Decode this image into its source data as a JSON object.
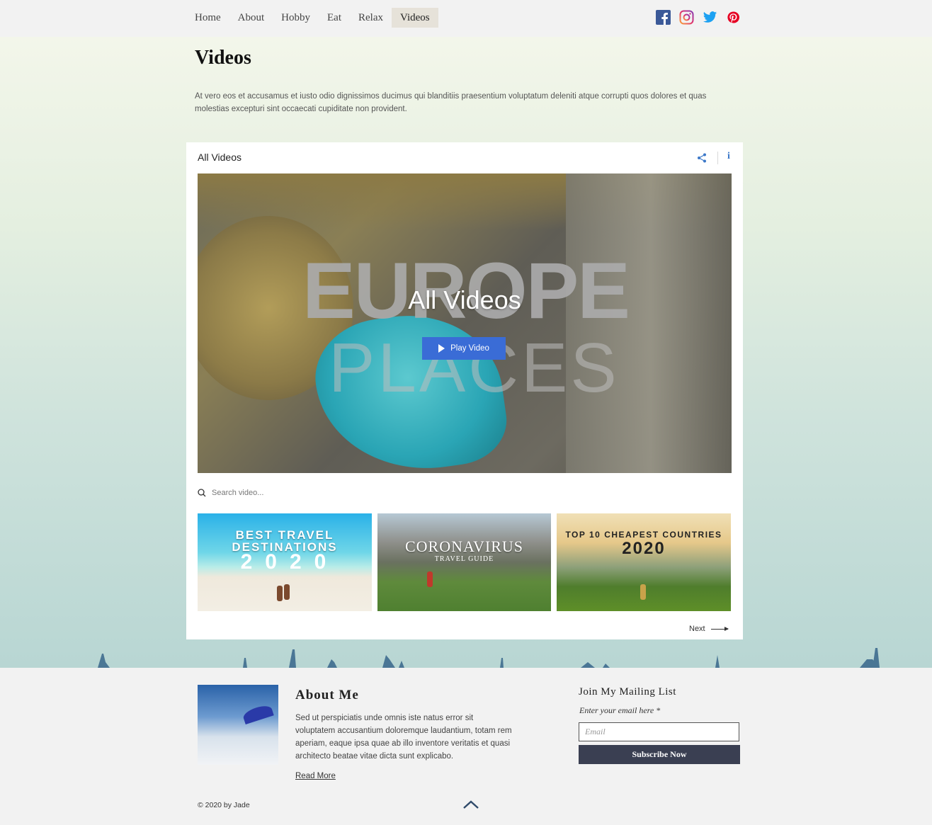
{
  "nav": {
    "items": [
      {
        "label": "Home",
        "active": false
      },
      {
        "label": "About",
        "active": false
      },
      {
        "label": "Hobby",
        "active": false
      },
      {
        "label": "Eat",
        "active": false
      },
      {
        "label": "Relax",
        "active": false
      },
      {
        "label": "Videos",
        "active": true
      }
    ],
    "social": [
      "facebook-icon",
      "instagram-icon",
      "twitter-icon",
      "pinterest-icon"
    ]
  },
  "page": {
    "title": "Videos",
    "intro": "At vero eos et accusamus et iusto odio dignissimos ducimus qui blanditiis praesentium voluptatum deleniti atque corrupti quos dolores et quas molestias excepturi sint occaecati cupiditate non provident."
  },
  "widget": {
    "title": "All Videos",
    "player": {
      "overlay_title": "All Videos",
      "play_label": "Play Video",
      "bg_text_1": "EUROPE",
      "bg_text_2": "PLACES"
    },
    "search": {
      "placeholder": "Search video..."
    },
    "thumbnails": [
      {
        "line1": "BEST TRAVEL DESTINATIONS",
        "line2": "2020"
      },
      {
        "line1": "CORONAVIRUS",
        "line2": "TRAVEL GUIDE"
      },
      {
        "line1": "TOP 10 CHEAPEST COUNTRIES",
        "line2": "2020"
      }
    ],
    "next_label": "Next"
  },
  "footer": {
    "about_title": "About Me",
    "about_text": "Sed ut perspiciatis unde omnis iste natus error sit voluptatem accusantium doloremque laudantium, totam rem aperiam, eaque ipsa quae ab illo inventore veritatis et quasi architecto beatae vitae dicta sunt explicabo.",
    "read_more": "Read More",
    "mail_title": "Join My Mailing List",
    "mail_label": "Enter your email here *",
    "mail_placeholder": "Email",
    "subscribe_label": "Subscribe Now",
    "copyright": "© 2020 by Jade"
  },
  "colors": {
    "accent": "#3a6cd6",
    "subscribe_bg": "#3a3f52",
    "active_nav_bg": "#e6e2d9"
  }
}
